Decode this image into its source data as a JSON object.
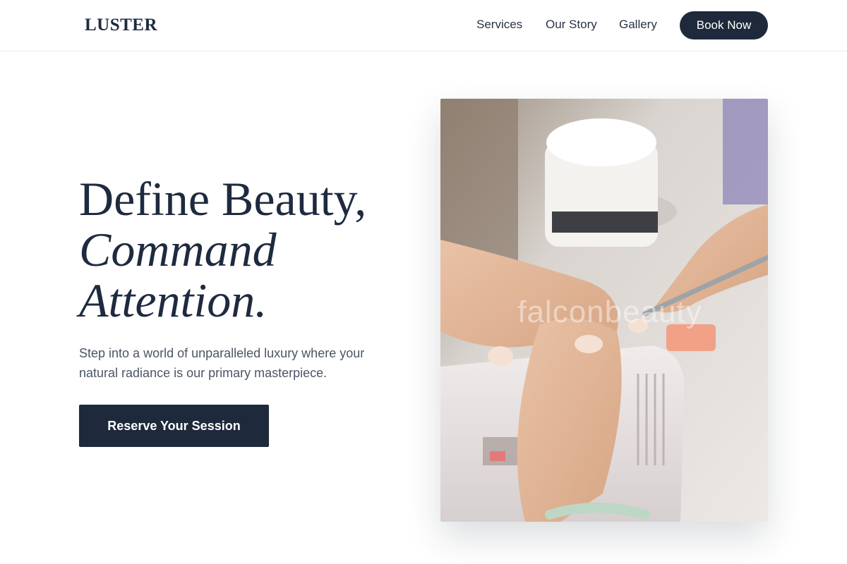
{
  "header": {
    "logo": "LUSTER",
    "nav": [
      "Services",
      "Our Story",
      "Gallery"
    ],
    "cta_label": "Book Now"
  },
  "hero": {
    "title_line1": "Define Beauty,",
    "title_line2": "Command",
    "title_line3": "Attention.",
    "subtitle": "Step into a world of unparalleled luxury where your natural radiance is our primary masterpiece.",
    "cta_label": "Reserve Your Session"
  },
  "image": {
    "watermark": "falconbeauty",
    "subject": "manicurist-hands-photo"
  },
  "colors": {
    "brand_navy": "#1e293b",
    "text_muted": "#4b5565",
    "background": "#ffffff"
  }
}
